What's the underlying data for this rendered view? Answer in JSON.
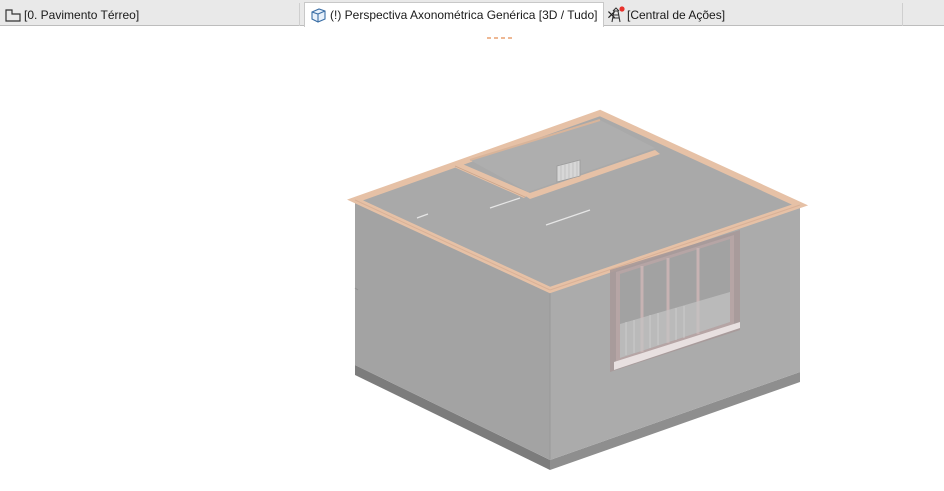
{
  "tabs": [
    {
      "label": "[0. Pavimento Térreo]",
      "icon": "floor-plan-icon",
      "active": false
    },
    {
      "label": "(!) Perspectiva Axonométrica Genérica [3D / Tudo]",
      "icon": "3d-cube-icon",
      "active": true,
      "close_label": "✕"
    },
    {
      "label": "[Central de Ações]",
      "icon": "action-center-icon",
      "active": false,
      "notification": true
    }
  ],
  "colors": {
    "wall": "#ababab",
    "wall_edge": "#8f8f8f",
    "slab_top": "#a8a8a8",
    "parapet": "#e6c1a6",
    "floor_base": "#8a8a8a",
    "window_frame": "#b39c9c",
    "loading_dash": "#e8a070"
  }
}
